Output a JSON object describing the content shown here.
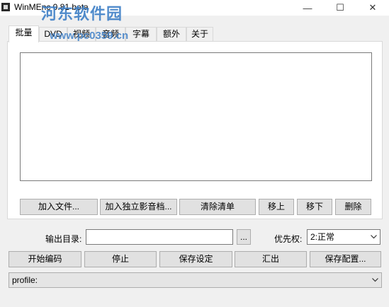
{
  "window": {
    "title": "WinMEnc 0.81 beta",
    "minimize": "—",
    "maximize": "☐",
    "close": "✕"
  },
  "watermark": {
    "logo_text": "河东软件园",
    "url": "www.pc0359.cn"
  },
  "tabs": [
    {
      "label": "批量",
      "active": true
    },
    {
      "label": "DVD"
    },
    {
      "label": "视频"
    },
    {
      "label": "音频"
    },
    {
      "label": "字幕"
    },
    {
      "label": "额外"
    },
    {
      "label": "关于"
    }
  ],
  "batch": {
    "buttons": {
      "add_file": "加入文件...",
      "add_standalone": "加入独立影音档...",
      "clear_list": "清除清单",
      "move_up": "移上",
      "move_down": "移下",
      "delete": "删除"
    }
  },
  "output": {
    "label": "输出目录:",
    "value": "",
    "browse": "..."
  },
  "priority": {
    "label": "优先权:",
    "selected": "2:正常"
  },
  "actions": {
    "start": "开始编码",
    "stop": "停止",
    "save_settings": "保存设定",
    "export": "汇出",
    "save_config": "保存配置..."
  },
  "profile": {
    "selected": "profile:"
  },
  "icons": {
    "app": "app-icon",
    "dropdown": "chevron-down-icon"
  }
}
